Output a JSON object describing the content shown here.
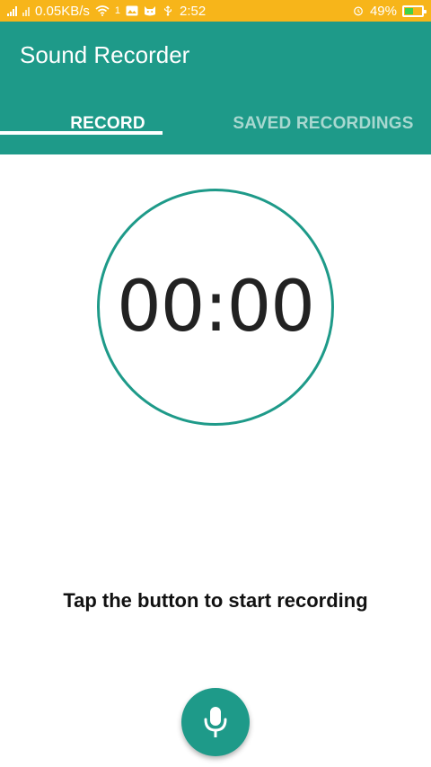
{
  "status_bar": {
    "speed": "0.05KB/s",
    "sim_indicator": "1",
    "time": "2:52",
    "battery": "49%",
    "battery_level_pct": 49
  },
  "app": {
    "title": "Sound Recorder",
    "accent": "#1e9a89",
    "status_color": "#f7b51a"
  },
  "tabs": [
    {
      "label": "RECORD",
      "active": true
    },
    {
      "label": "SAVED RECORDINGS",
      "active": false
    }
  ],
  "timer": {
    "value": "00:00"
  },
  "hint": {
    "text": "Tap the button to start recording"
  },
  "fab": {
    "icon": "microphone-icon"
  }
}
